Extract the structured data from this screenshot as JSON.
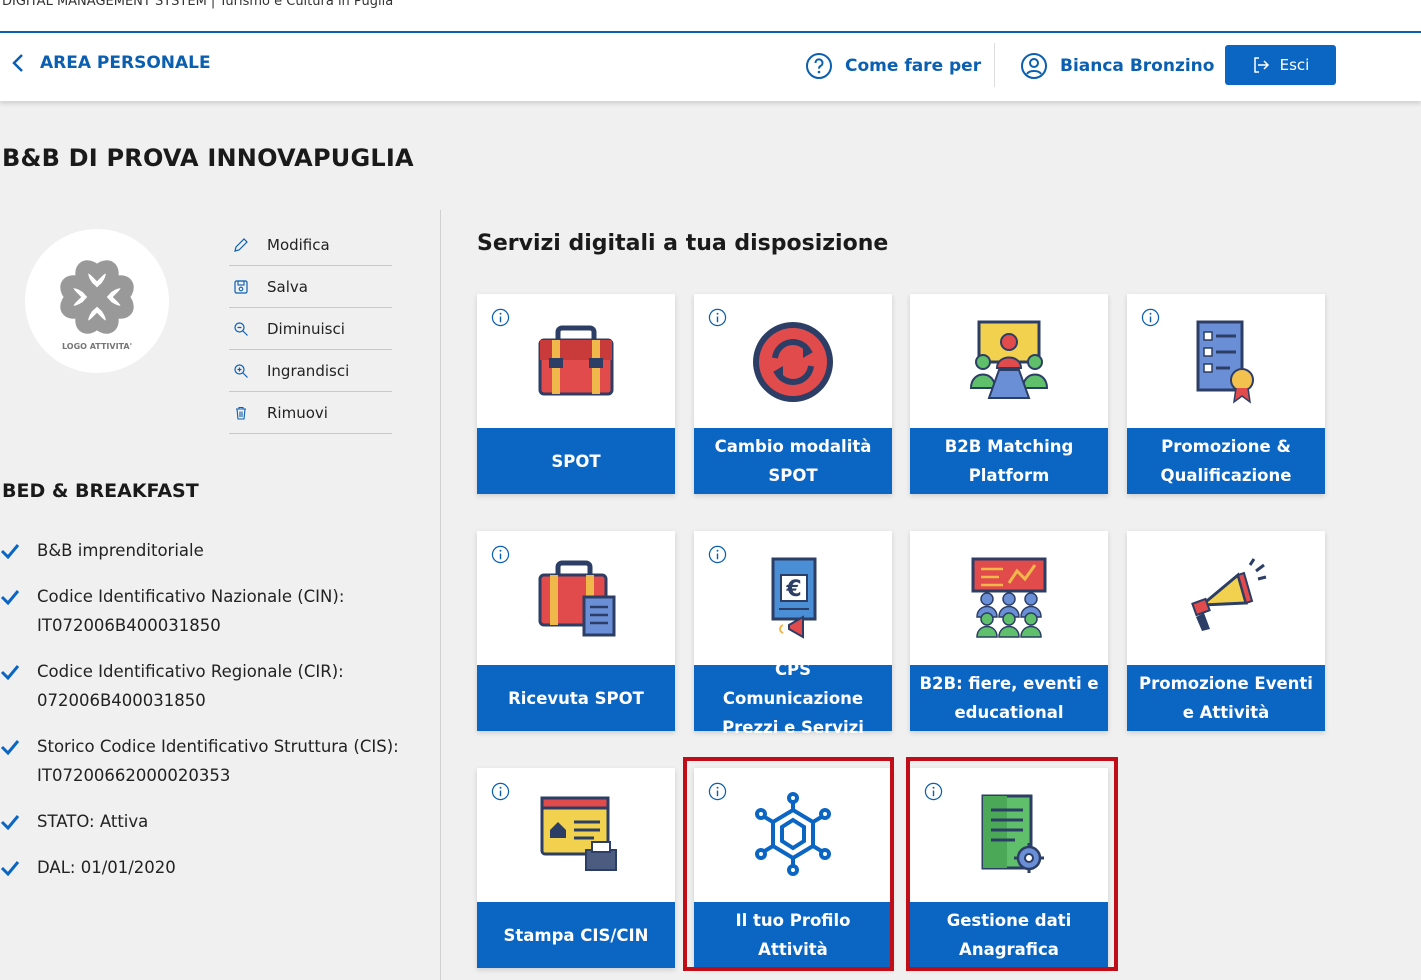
{
  "top_strip": {
    "text": "DIGITAL MANAGEMENT SYSTEM | Turismo e Cultura in Puglia"
  },
  "header": {
    "back_label": "AREA PERSONALE",
    "help_label": "Come fare per",
    "user_name": "Bianca Bronzino",
    "logout_label": "Esci"
  },
  "page_title": "B&B DI PROVA INNOVAPUGLIA",
  "logo": {
    "caption": "LOGO ATTIVITA'"
  },
  "logo_actions": [
    {
      "label": "Modifica",
      "icon": "pencil-icon"
    },
    {
      "label": "Salva",
      "icon": "save-icon"
    },
    {
      "label": "Diminuisci",
      "icon": "zoom-out-icon"
    },
    {
      "label": "Ingrandisci",
      "icon": "zoom-in-icon"
    },
    {
      "label": "Rimuovi",
      "icon": "trash-icon"
    }
  ],
  "category": "BED & BREAKFAST",
  "details": [
    {
      "line1": "B&B imprenditoriale",
      "line2": ""
    },
    {
      "line1": "Codice Identificativo Nazionale (CIN):",
      "line2": "IT072006B400031850"
    },
    {
      "line1": "Codice Identificativo Regionale (CIR):",
      "line2": "072006B400031850"
    },
    {
      "line1": "Storico Codice Identificativo Struttura (CIS):",
      "line2": "IT07200662000020353"
    },
    {
      "line1": "STATO: Attiva",
      "line2": ""
    },
    {
      "line1": "DAL: 01/01/2020",
      "line2": ""
    }
  ],
  "services_title": "Servizi digitali a tua disposizione",
  "services": [
    {
      "label": "SPOT",
      "icon": "briefcase-icon",
      "highlighted": false
    },
    {
      "label": "Cambio modalità SPOT",
      "icon": "refresh-icon",
      "highlighted": false
    },
    {
      "label": "B2B Matching Platform",
      "icon": "meeting-icon",
      "highlighted": false
    },
    {
      "label": "Promozione & Qualificazione",
      "icon": "certificate-icon",
      "highlighted": false
    },
    {
      "label": "Ricevuta SPOT",
      "icon": "briefcase-receipt-icon",
      "highlighted": false
    },
    {
      "label": "CPS Comunicazione Prezzi e Servizi",
      "icon": "euro-document-icon",
      "highlighted": false
    },
    {
      "label": "B2B: fiere, eventi e educational",
      "icon": "conference-icon",
      "highlighted": false
    },
    {
      "label": "Promozione Eventi e Attività",
      "icon": "megaphone-icon",
      "highlighted": false
    },
    {
      "label": "Stampa CIS/CIN",
      "icon": "print-icon",
      "highlighted": false
    },
    {
      "label": "Il tuo Profilo Attività",
      "icon": "network-icon",
      "highlighted": true
    },
    {
      "label": "Gestione dati Anagrafica",
      "icon": "document-settings-icon",
      "highlighted": true
    }
  ],
  "colors": {
    "primary": "#0b66c3",
    "highlight": "#c00d17",
    "background": "#f0f0f0"
  }
}
